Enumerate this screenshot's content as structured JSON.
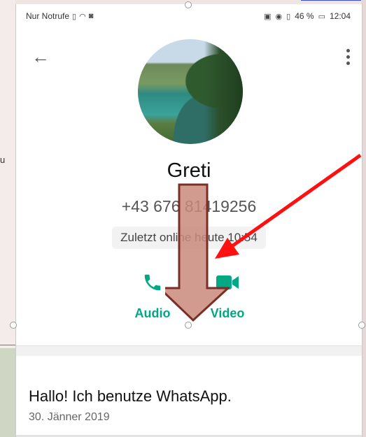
{
  "status_bar": {
    "carrier": "Nur Notrufe",
    "battery": "46 %",
    "time": "12:04"
  },
  "profile": {
    "name": "Greti",
    "phone": "+43 676 81419256",
    "last_seen": "Zuletzt online heute 10:54"
  },
  "actions": {
    "audio_label": "Audio",
    "video_label": "Video"
  },
  "about": {
    "text": "Hallo! Ich benutze WhatsApp.",
    "date": "30. Jänner 2019"
  },
  "background": {
    "left_fragment": "u"
  },
  "colors": {
    "accent": "#00a884",
    "annotation_red": "#ff1010",
    "annotation_arrow_fill": "#c98a7c",
    "annotation_arrow_stroke": "#7a2e25"
  },
  "icons": {
    "back": "back-arrow-icon",
    "more": "more-vertical-icon",
    "audio": "phone-icon",
    "video": "video-camera-icon"
  }
}
